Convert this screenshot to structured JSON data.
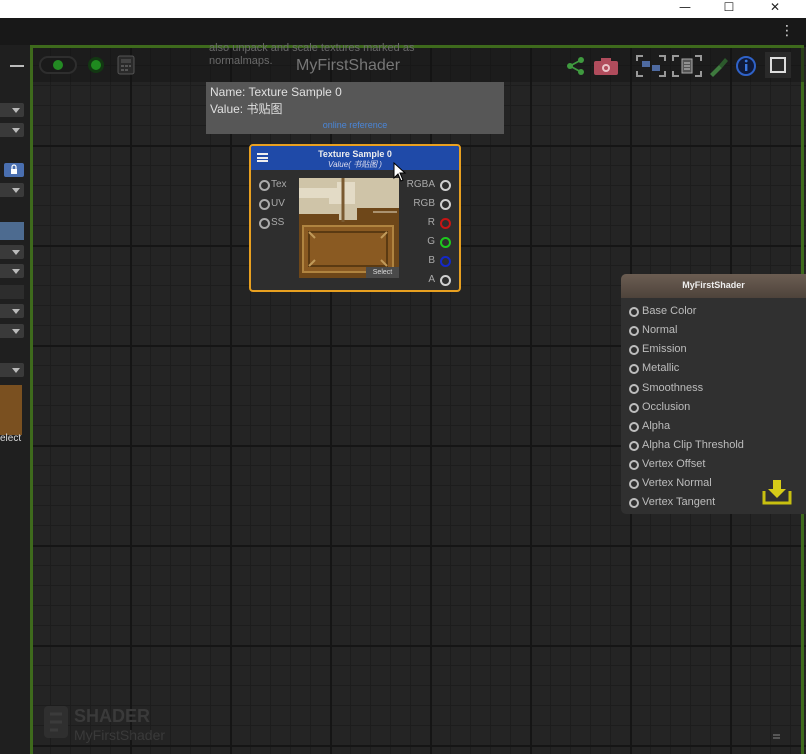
{
  "window": {
    "minimize": "—",
    "maximize": "☐",
    "close": "✕"
  },
  "tabbar": {
    "menu": "⋮"
  },
  "left_panel": {
    "select_label": "elect"
  },
  "toolbar": {
    "shader_title": "MyFirstShader",
    "icons": [
      "toggle-live-icon",
      "live-indicator-icon",
      "calculator-icon",
      "share-icon",
      "camera-icon",
      "fit-nodes-icon",
      "clipboard-icon",
      "paint-brush-icon",
      "info-icon",
      "maximize-icon"
    ]
  },
  "tooltip": {
    "ghost_text": "also unpack and scale textures marked as normalmaps.",
    "name_line": "Name: Texture Sample 0",
    "value_line": "Value: 书贴图",
    "link": "online reference"
  },
  "texture_node": {
    "title": "Texture Sample 0",
    "subtitle": "Value( 书贴图 )",
    "inputs": [
      "Tex",
      "UV",
      "SS"
    ],
    "outputs": [
      {
        "label": "RGBA",
        "color": "#d0d0d0"
      },
      {
        "label": "RGB",
        "color": "#d0d0d0"
      },
      {
        "label": "R",
        "color": "#c81414"
      },
      {
        "label": "G",
        "color": "#1ec81e"
      },
      {
        "label": "B",
        "color": "#1428c8"
      },
      {
        "label": "A",
        "color": "#d0d0d0"
      }
    ],
    "select_label": "Select"
  },
  "master_node": {
    "title": "MyFirstShader",
    "inputs": [
      "Base Color",
      "Normal",
      "Emission",
      "Metallic",
      "Smoothness",
      "Occlusion",
      "Alpha",
      "Alpha Clip Threshold",
      "Vertex Offset",
      "Vertex Normal",
      "Vertex Tangent"
    ]
  },
  "watermark": {
    "line1": "SHADER",
    "line2": "MyFirstShader"
  },
  "colors": {
    "accent_green": "#3e6a1c",
    "node_border": "#e8a020",
    "node_header": "#1f4aa8"
  }
}
